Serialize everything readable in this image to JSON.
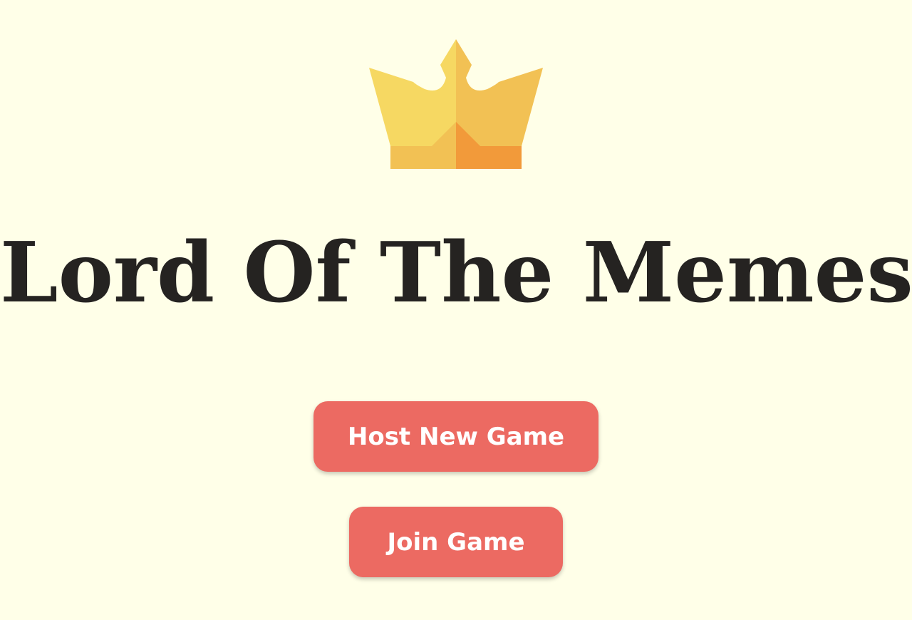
{
  "logo": {
    "icon": "crown-icon",
    "colors": {
      "light_gold": "#F6D862",
      "gold": "#F2C154",
      "orange": "#F29A3A"
    }
  },
  "title": "Lord Of The Memes",
  "buttons": {
    "host_label": "Host New Game",
    "join_label": "Join Game"
  },
  "colors": {
    "background": "#FFFFE8",
    "title_text": "#252321",
    "button_bg": "#EC6A62",
    "button_text": "#FFFFFF"
  }
}
